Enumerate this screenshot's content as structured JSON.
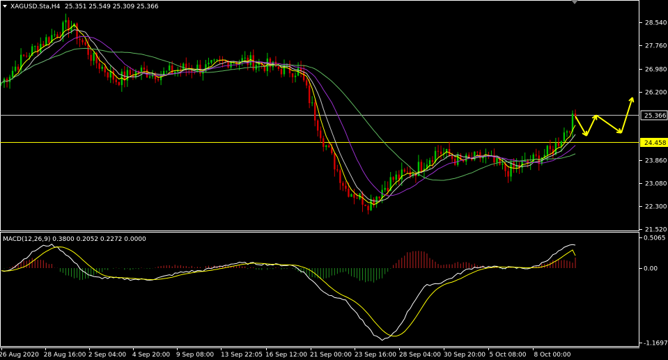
{
  "header": {
    "symbol": "XAGUSD.Sta,H4",
    "ohlc": "25.351 25.549 25.309 25.366"
  },
  "macd_header": {
    "label": "MACD(12,26,9) 0.3800 0.2052 0.2272 0.0000"
  },
  "colors": {
    "background": "#000000",
    "frame": "#ffffff",
    "bull_candle": "#00c400",
    "bear_candle": "#d40000",
    "ma_fast": "#ffff00",
    "ma_mid": "#c8c8c8",
    "ma_slow_purple": "#9b30d0",
    "ma_slow_green": "#5fb85f",
    "hist_pos": "#c02020",
    "hist_neg": "#1f8a1f",
    "macd_line": "#ffffff",
    "signal_line": "#ffff00",
    "arrow": "#ffff00",
    "level_line": "#c8c8c8",
    "level_line2": "#ffff00"
  },
  "chart_data": [
    {
      "type": "candlestick",
      "series_name": "XAGUSD.Sta,H4",
      "y_ticks": [
        28.54,
        27.76,
        26.98,
        26.2,
        25.366,
        24.458,
        23.86,
        23.08,
        22.3,
        21.52
      ],
      "y_tick_labels": [
        "28.540",
        "27.760",
        "26.980",
        "26.200",
        "25.366",
        "24.458",
        "23.860",
        "23.080",
        "22.300",
        "21.520"
      ],
      "ylim": [
        21.42,
        29.2
      ],
      "horizontal_levels": [
        {
          "value": 25.366,
          "label": "25.366",
          "style": "current-price"
        },
        {
          "value": 24.458,
          "label": "24.458",
          "style": "support"
        }
      ],
      "x_labels": [
        "26 Aug 2020",
        "28 Aug 16:00",
        "2 Sep 04:00",
        "4 Sep 20:00",
        "9 Sep 08:00",
        "13 Sep 22:05",
        "16 Sep 12:00",
        "21 Sep 00:00",
        "23 Sep 16:00",
        "28 Sep 04:00",
        "30 Sep 20:00",
        "5 Oct 08:00",
        "8 Oct 00:00"
      ],
      "price_path": [
        {
          "t": "26 Aug 2020",
          "close": 26.5
        },
        {
          "t": "27 Aug",
          "close": 27.4
        },
        {
          "t": "28 Aug 16:00",
          "close": 28.0
        },
        {
          "t": "1 Sep",
          "close": 28.5
        },
        {
          "t": "2 Sep 04:00",
          "close": 27.3
        },
        {
          "t": "3 Sep",
          "close": 26.6
        },
        {
          "t": "4 Sep 20:00",
          "close": 26.9
        },
        {
          "t": "8 Sep",
          "close": 26.8
        },
        {
          "t": "9 Sep 08:00",
          "close": 27.0
        },
        {
          "t": "11 Sep",
          "close": 27.0
        },
        {
          "t": "13 Sep 22:05",
          "close": 27.3
        },
        {
          "t": "15 Sep",
          "close": 27.2
        },
        {
          "t": "16 Sep 12:00",
          "close": 27.0
        },
        {
          "t": "18 Sep",
          "close": 26.9
        },
        {
          "t": "21 Sep 00:00",
          "close": 24.6
        },
        {
          "t": "22 Sep",
          "close": 22.9
        },
        {
          "t": "23 Sep 16:00",
          "close": 22.4
        },
        {
          "t": "25 Sep",
          "close": 23.2
        },
        {
          "t": "28 Sep 04:00",
          "close": 23.5
        },
        {
          "t": "29 Sep",
          "close": 24.2
        },
        {
          "t": "30 Sep 20:00",
          "close": 23.8
        },
        {
          "t": "2 Oct",
          "close": 24.0
        },
        {
          "t": "5 Oct 08:00",
          "close": 23.5
        },
        {
          "t": "6 Oct",
          "close": 23.8
        },
        {
          "t": "8 Oct 00:00",
          "close": 24.2
        },
        {
          "t": "9 Oct",
          "close": 25.366
        }
      ],
      "forecast_arrows": [
        25.366,
        24.7,
        25.4,
        24.8,
        26.0
      ]
    },
    {
      "type": "histogram+line",
      "series_name": "MACD(12,26,9)",
      "values": {
        "main": 0.38,
        "signal": 0.2052,
        "histogram": 0.2272,
        "other": 0.0
      },
      "y_ticks": [
        0.5065,
        0.0,
        -1.1697
      ],
      "y_tick_labels": [
        "0.5065",
        "0.00",
        "-1.1697"
      ],
      "ylim": [
        -1.2,
        0.6
      ],
      "macd_path": [
        {
          "t": "26 Aug 2020",
          "v": -0.05
        },
        {
          "t": "28 Aug 16:00",
          "v": 0.38
        },
        {
          "t": "2 Sep 04:00",
          "v": -0.15
        },
        {
          "t": "4 Sep 20:00",
          "v": -0.18
        },
        {
          "t": "9 Sep 08:00",
          "v": -0.05
        },
        {
          "t": "13 Sep 22:05",
          "v": 0.08
        },
        {
          "t": "16 Sep 12:00",
          "v": 0.05
        },
        {
          "t": "21 Sep 00:00",
          "v": -0.45
        },
        {
          "t": "23 Sep 16:00",
          "v": -1.12
        },
        {
          "t": "28 Sep 04:00",
          "v": -0.25
        },
        {
          "t": "30 Sep 20:00",
          "v": 0.02
        },
        {
          "t": "5 Oct 08:00",
          "v": 0.0
        },
        {
          "t": "8 Oct 00:00",
          "v": 0.38
        }
      ]
    }
  ]
}
